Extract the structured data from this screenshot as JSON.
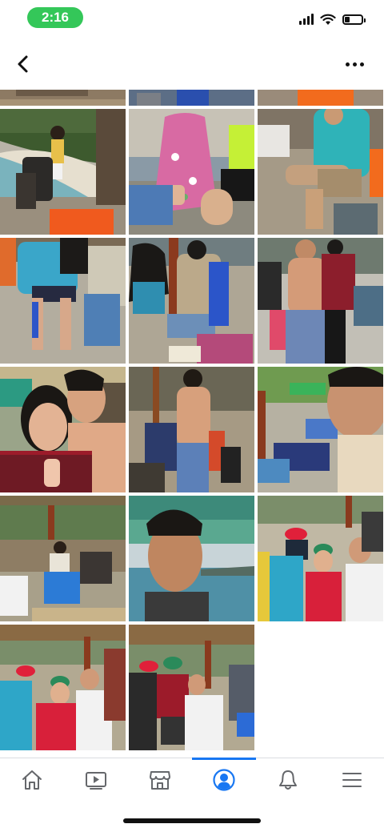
{
  "status_bar": {
    "time": "2:16",
    "battery_level": 0.3,
    "colors": {
      "time_pill": "#34c759"
    }
  },
  "nav": {
    "back_icon": "chevron-left-icon",
    "more_icon": "more-horizontal-icon"
  },
  "photos": [
    {
      "name": "photo-beach-person-bags"
    },
    {
      "name": "photo-woman-floral-dress-seated"
    },
    {
      "name": "photo-man-teal-shirt-seated"
    },
    {
      "name": "photo-girls-blue-chairs"
    },
    {
      "name": "photo-woman-striped-shirt-chair"
    },
    {
      "name": "photo-shirtless-man-group"
    },
    {
      "name": "photo-selfie-couple"
    },
    {
      "name": "photo-shirtless-man-standing"
    },
    {
      "name": "photo-selfie-man-hammocks"
    },
    {
      "name": "photo-group-under-hut"
    },
    {
      "name": "photo-man-smiling-sea"
    },
    {
      "name": "photo-group-red-cap"
    },
    {
      "name": "photo-group-hut-left"
    },
    {
      "name": "photo-group-hut-right"
    }
  ],
  "tab_bar": {
    "tabs": [
      {
        "name": "tab-home",
        "icon": "home-icon",
        "active": false
      },
      {
        "name": "tab-watch",
        "icon": "video-play-icon",
        "active": false
      },
      {
        "name": "tab-marketplace",
        "icon": "marketplace-shop-icon",
        "active": false
      },
      {
        "name": "tab-profile",
        "icon": "profile-icon",
        "active": true
      },
      {
        "name": "tab-notifications",
        "icon": "bell-icon",
        "active": false
      },
      {
        "name": "tab-menu",
        "icon": "menu-icon",
        "active": false
      }
    ],
    "colors": {
      "active": "#1877f2",
      "inactive": "#65676b"
    }
  }
}
